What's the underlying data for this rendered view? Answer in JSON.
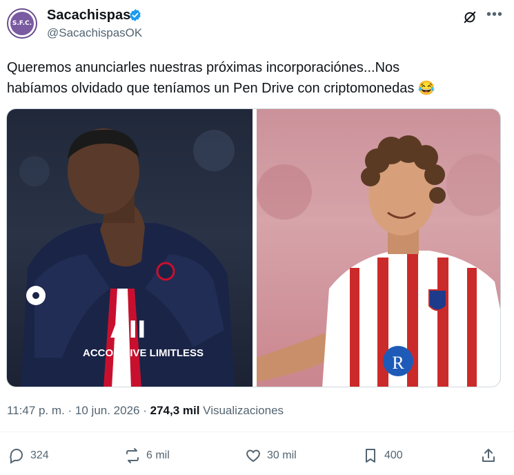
{
  "account": {
    "name": "Sacachispas",
    "handle": "@SacachispasOK",
    "avatar_text": "S.F.C."
  },
  "tweet": {
    "text_line1": "Queremos anunciarles nuestras próximas incorporaciónes...Nos",
    "text_line2": "habíamos olvidado que teníamos un Pen Drive con criptomonedas 😂"
  },
  "media": {
    "left_shirt_text": "ACCOR LIVE LIMITLESS",
    "left_shirt_short": "AII"
  },
  "meta": {
    "time": "11:47 p. m.",
    "sep1": " · ",
    "date": "10 jun. 2026",
    "sep2": " · ",
    "views_count": "274,3 mil",
    "views_label": " Visualizaciones"
  },
  "actions": {
    "replies": "324",
    "reposts": "6 mil",
    "likes": "30 mil",
    "bookmarks": "400"
  },
  "colors": {
    "verified": "#1d9bf0",
    "secondary_text": "#536471"
  }
}
